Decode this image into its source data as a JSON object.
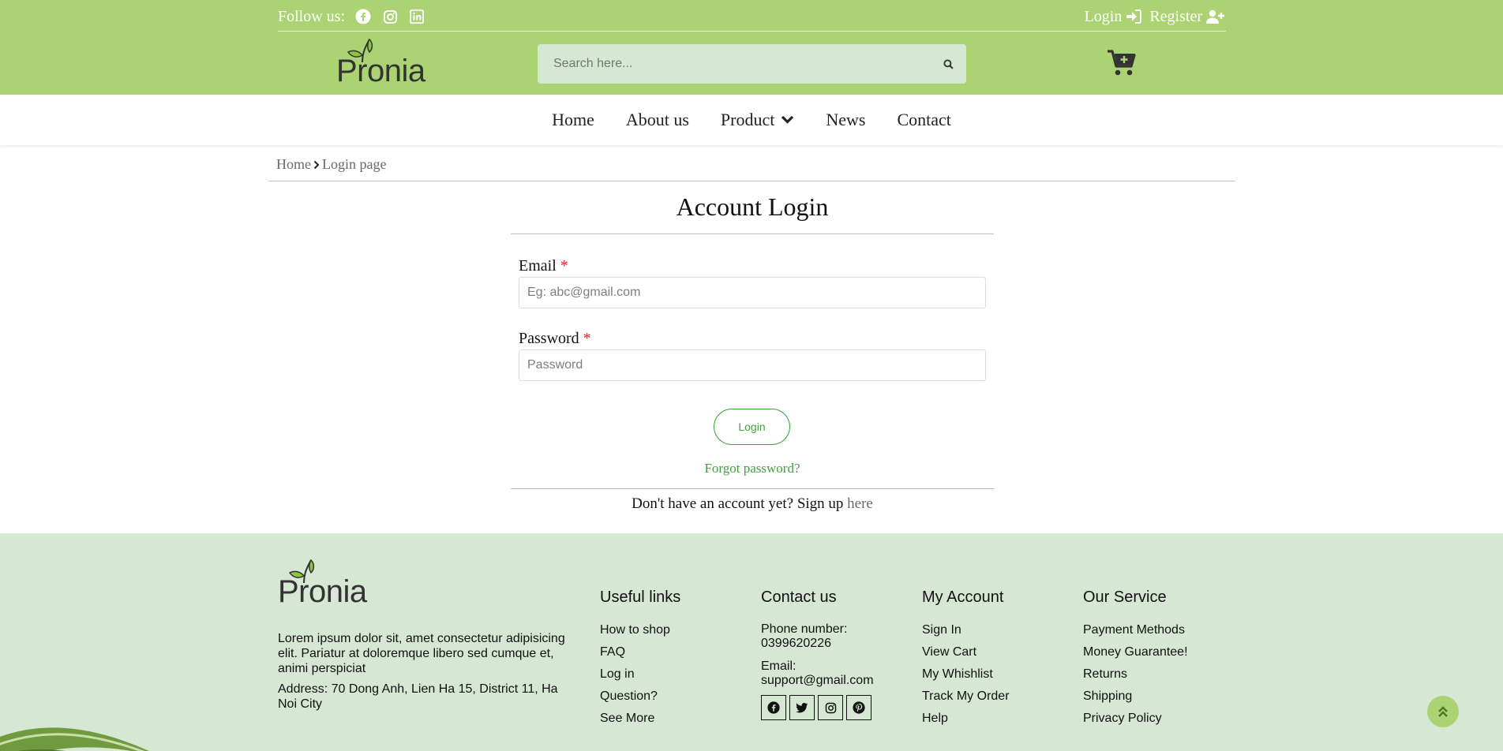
{
  "header": {
    "follow_label": "Follow us:",
    "social": [
      "facebook-icon",
      "instagram-icon",
      "linkedin-icon"
    ],
    "login_label": "Login",
    "register_label": "Register",
    "logo_text": "Pronia",
    "search_placeholder": "Search here...",
    "colors": {
      "bar": "#abd373",
      "search_bg": "#d6e7d4"
    }
  },
  "nav": {
    "items": [
      {
        "label": "Home"
      },
      {
        "label": "About us"
      },
      {
        "label": "Product",
        "has_dropdown": true
      },
      {
        "label": "News"
      },
      {
        "label": "Contact"
      }
    ]
  },
  "breadcrumb": {
    "home": "Home",
    "current": "Login page"
  },
  "form": {
    "title": "Account Login",
    "email_label": "Email",
    "email_placeholder": "Eg: abc@gmail.com",
    "password_label": "Password",
    "password_placeholder": "Password",
    "required_mark": "*",
    "login_button": "Login",
    "forgot": "Forgot password?",
    "signup_text": "Don't have an account yet? Sign up",
    "signup_link": "here",
    "accent": "#3fa33a"
  },
  "footer": {
    "logo_text": "Pronia",
    "about": "Lorem ipsum dolor sit, amet consectetur adipisicing elit. Pariatur at doloremque libero sed cumque et, animi perspiciat",
    "address": "Address: 70 Dong Anh, Lien Ha 15, District 11, Ha Noi City",
    "useful_links": {
      "title": "Useful links",
      "items": [
        "How to shop",
        "FAQ",
        "Log in",
        "Question?",
        "See More"
      ]
    },
    "contact": {
      "title": "Contact us",
      "phone_label": "Phone number:",
      "phone": "0399620226",
      "email_label": "Email:",
      "email": "support@gmail.com",
      "social": [
        "facebook-icon",
        "twitter-icon",
        "instagram-icon",
        "pinterest-icon"
      ]
    },
    "my_account": {
      "title": "My Account",
      "items": [
        "Sign In",
        "View Cart",
        "My Whishlist",
        "Track My Order",
        "Help"
      ]
    },
    "our_service": {
      "title": "Our Service",
      "items": [
        "Payment Methods",
        "Money Guarantee!",
        "Returns",
        "Shipping",
        "Privacy Policy"
      ]
    },
    "bg": "#d6e7d4"
  }
}
